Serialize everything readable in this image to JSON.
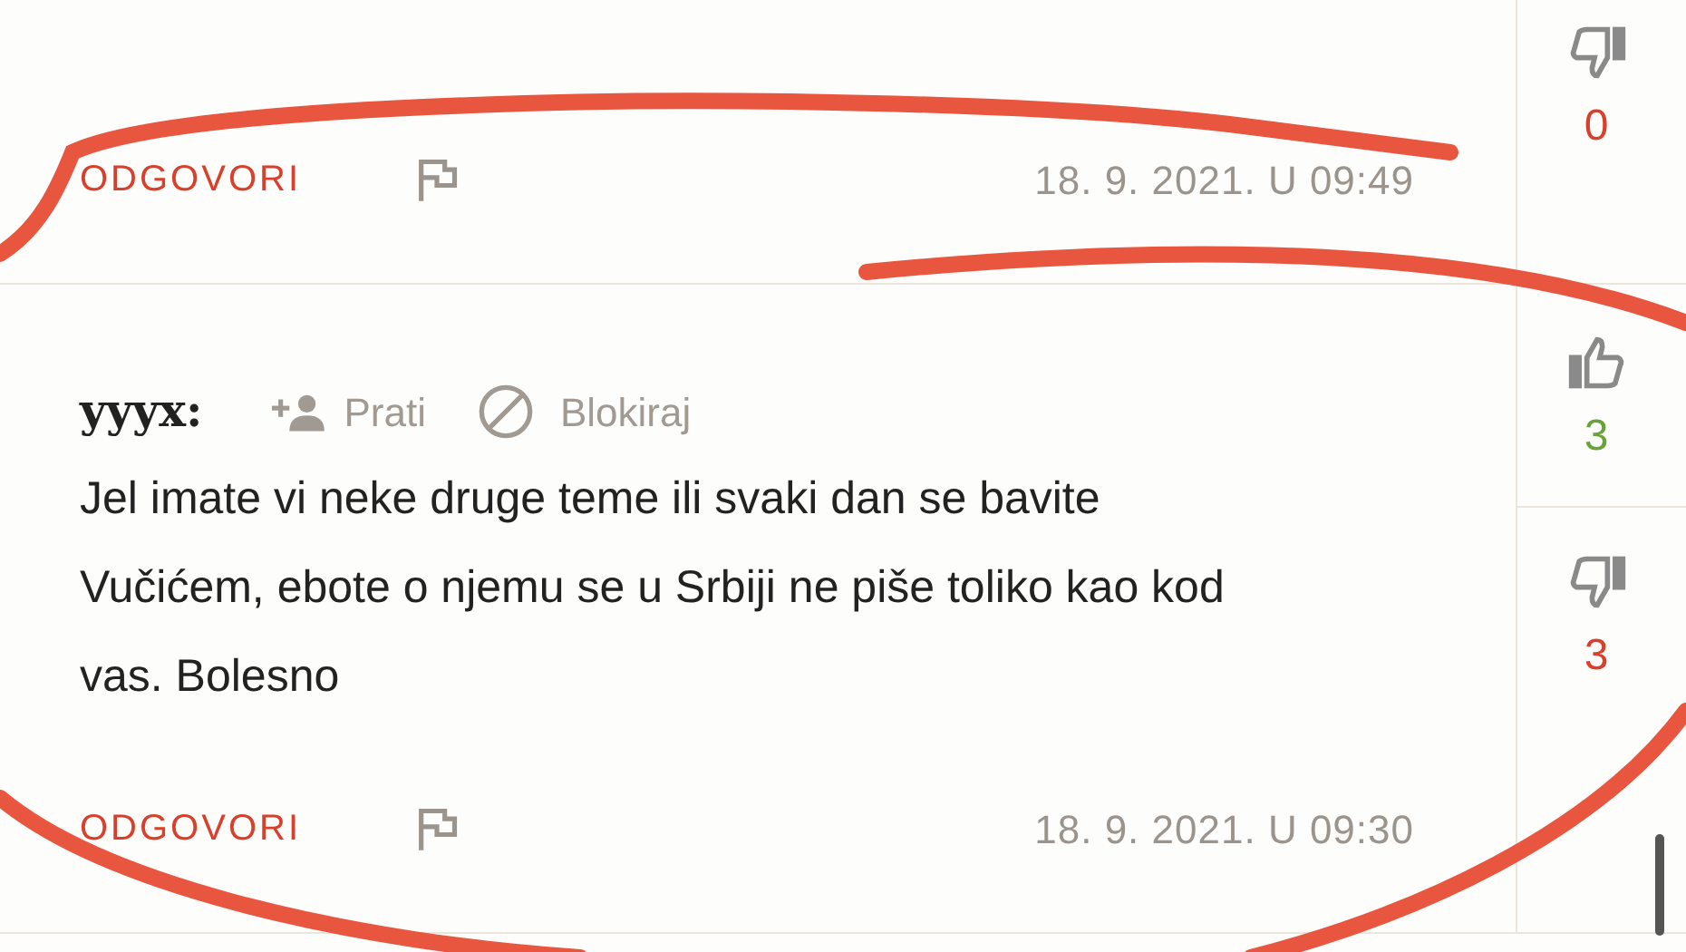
{
  "comments": [
    {
      "reply_label": "ODGOVORI",
      "date": "18. 9. 2021. U 09:49",
      "votes": [
        {
          "kind": "dislike",
          "count": "0"
        }
      ]
    },
    {
      "author": "yyyx:",
      "follow_label": "Prati",
      "block_label": "Blokiraj",
      "text": "Jel imate vi neke druge teme ili svaki dan se bavite Vučićem, ebote o njemu se u Srbiji ne piše toliko kao kod vas. Bolesno",
      "reply_label": "ODGOVORI",
      "date": "18. 9. 2021. U 09:30",
      "votes": [
        {
          "kind": "like",
          "count": "3"
        },
        {
          "kind": "dislike",
          "count": "3"
        }
      ]
    }
  ]
}
